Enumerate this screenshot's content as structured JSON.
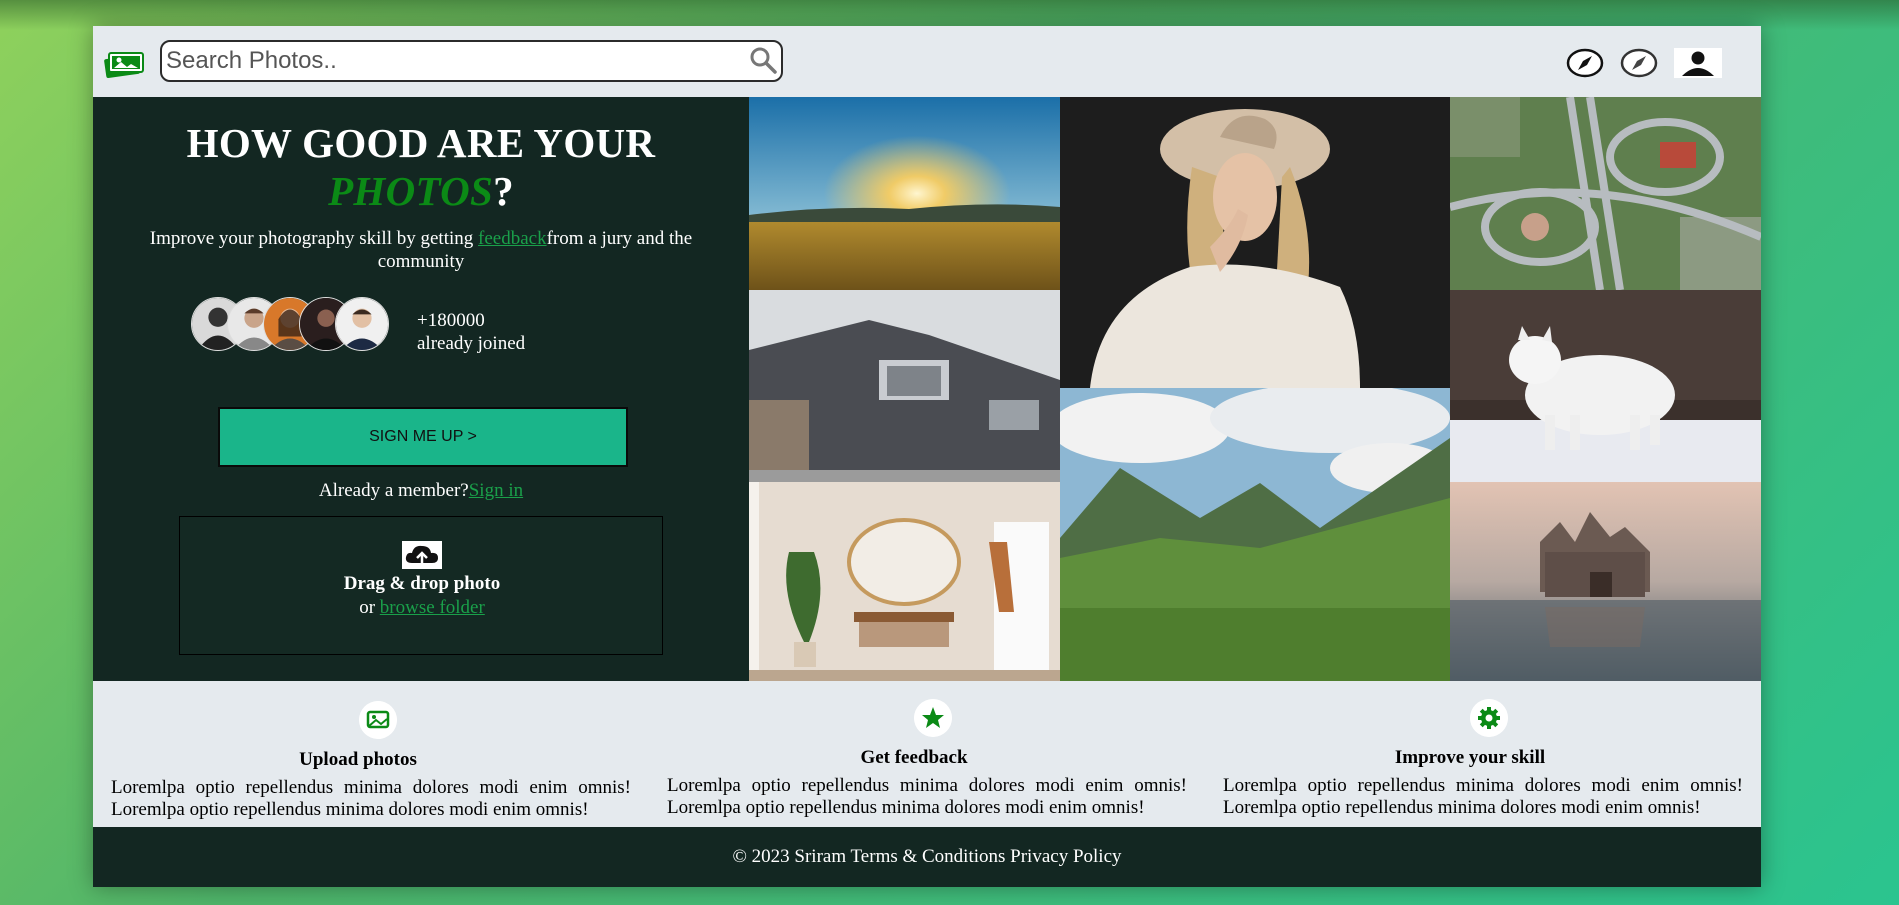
{
  "header": {
    "search_placeholder": "Search Photos..",
    "icons": [
      "photos-logo-icon",
      "search-icon",
      "compass-icon",
      "compass-icon",
      "user-icon"
    ]
  },
  "hero": {
    "title_line1": "HOW GOOD ARE YOUR",
    "title_accent": "PHOTOS",
    "title_suffix": "?",
    "subtitle_before": "Improve your photography skill by getting ",
    "subtitle_link": "feedback",
    "subtitle_after": "from a jury and the community",
    "joined_count": "+180000",
    "joined_text": "already joined",
    "signup_label": "SIGN ME UP >",
    "member_text": "Already a member?",
    "signin_link": "Sign in",
    "drop_title": "Drag & drop photo",
    "drop_or": "or ",
    "drop_link": "browse folder"
  },
  "photos": [
    {
      "subject": "sunset over wheat field"
    },
    {
      "subject": "woman in hat"
    },
    {
      "subject": "highway interchange aerial"
    },
    {
      "subject": "modern house"
    },
    {
      "subject": "white arctic wolf"
    },
    {
      "subject": "green mountain valley"
    },
    {
      "subject": "entryway with mirror"
    },
    {
      "subject": "castle in fog"
    }
  ],
  "features": [
    {
      "title": "Upload photos",
      "text": "Loremlpa optio repellendus minima dolores modi enim omnis! Loremlpa optio repellendus minima dolores modi enim omnis!",
      "icon": "image-icon"
    },
    {
      "title": "Get feedback",
      "text": "Loremlpa optio repellendus minima dolores modi enim omnis! Loremlpa optio repellendus minima dolores modi enim omnis!",
      "icon": "star-icon"
    },
    {
      "title": "Improve your skill",
      "text": "Loremlpa optio repellendus minima dolores modi enim omnis! Loremlpa optio repellendus minima dolores modi enim omnis!",
      "icon": "gear-icon"
    }
  ],
  "footer": {
    "text": "© 2023 Sriram Terms & Conditions Privacy Policy"
  },
  "colors": {
    "dark_green": "#132722",
    "accent_green": "#0b8a16",
    "button_teal": "#1ab58a",
    "light_bg": "#e5eaee"
  }
}
